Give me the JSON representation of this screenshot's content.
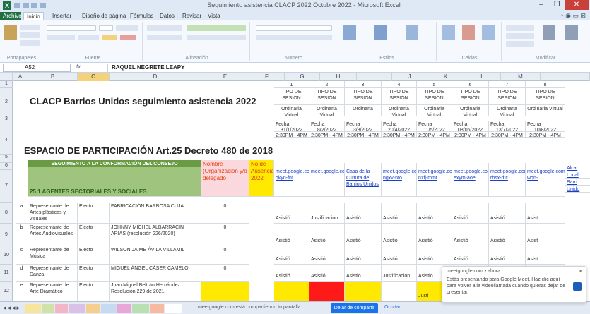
{
  "window": {
    "title": "Seguimiento asistencia CLACP 2022 Octubre 2022 - Microsoft Excel",
    "app_icon": "X",
    "minimize": "–",
    "maximize": "❐",
    "close": "✕"
  },
  "ribbon_tabs": [
    "Archivo",
    "Inicio",
    "Insertar",
    "Diseño de página",
    "Fórmulas",
    "Datos",
    "Revisar",
    "Vista"
  ],
  "ribbon_groups": [
    "Portapapeles",
    "Fuente",
    "Alineación",
    "Número",
    "Estilos",
    "Celdas",
    "Modificar"
  ],
  "formula_bar": {
    "name_box": "A52",
    "fx": "fx",
    "content": "RAQUEL NEGRETE LEAPY"
  },
  "columns": [
    {
      "label": "A",
      "selected": false
    },
    {
      "label": "B",
      "selected": false
    },
    {
      "label": "C",
      "selected": true
    },
    {
      "label": "D",
      "selected": false
    },
    {
      "label": "E",
      "selected": false
    },
    {
      "label": "F",
      "selected": false
    },
    {
      "label": "G",
      "selected": false
    },
    {
      "label": "H",
      "selected": false
    },
    {
      "label": "I",
      "selected": false
    },
    {
      "label": "J",
      "selected": false
    },
    {
      "label": "K",
      "selected": false
    },
    {
      "label": "L",
      "selected": false
    },
    {
      "label": "M",
      "selected": false
    }
  ],
  "row_numbers": [
    "1",
    "2",
    "3",
    "4",
    "5",
    "6",
    "7",
    "8",
    "9",
    "10",
    "11",
    "12"
  ],
  "sheet": {
    "title": "CLACP Barrios Unidos seguimiento asistencia 2022",
    "subtitle": "ESPACIO DE PARTICIPACIÓN Art.25 Decreto 480 de 2018",
    "section_header": "SEGUIMIENTO A LA CONFORMACIÓN DEL CONSEJO",
    "section_label": "25.1 AGENTES SECTORIALES Y SOCIALES",
    "header_nombre": "Nombre (Organización y/o delegado",
    "header_ausencias": "No de Ausencias 2022",
    "session_numbers": [
      "1",
      "2",
      "3",
      "4",
      "5",
      "6",
      "7",
      "8"
    ],
    "session_type_label": "TIPO DE SESIÓN",
    "session_modes": [
      "Ordinaria Virtual",
      "Ordinaria Virtual",
      "Ordinaria",
      "Ordinaria Virtual",
      "Ordinaria Virtual",
      "Ordinaria Virtual",
      "Ordinaria Virtual",
      "Ordinaria Virtual"
    ],
    "fecha_label": "Fecha",
    "session_dates": [
      "31/1/2022",
      "8/2/2022",
      "3/3/2022",
      "20/4/2022",
      "11/5/2022",
      "08/06/2022",
      "13/7/2022",
      "10/8/2022"
    ],
    "session_times": [
      "2:30PM - 4PM",
      "2:30PM - 4PM",
      "2:30PM - 4PM",
      "2:30PM - 4PM",
      "2:30PM - 4PM",
      "2:30PM - 4PM",
      "2:30PM - 4PM",
      "2:30PM - 4PM"
    ],
    "session_links": [
      "meet.google.com/kfe-qkyn-fnf",
      "meet.google.com/xzb-",
      "Casa de la Cultura de Barrios Unidos",
      "meet.google.com/wde-ngxv-nto",
      "meet.google.com/ebs-nzfj-mmt",
      "meet.google.com/qgeq-exym-aoe",
      "meet.google.com/mbq-rhsx-dtc",
      "meet.google.com/jpt-wqn-"
    ],
    "col_m_links": [
      "Alcal",
      "Local",
      "Barri",
      "Unido"
    ],
    "rows": [
      {
        "letter": "a",
        "sector": "Representante de Artes plásticas y visuales",
        "tipo": "Electo",
        "nombre": "FABRICACIÓN BARBOSA CUJA",
        "ausencias": "0",
        "asistencia": [
          "Asistió",
          "Justificación",
          "Asistió",
          "Asistió",
          "Asistió",
          "Asistió",
          "Asistió",
          "Asist"
        ]
      },
      {
        "letter": "b",
        "sector": "Representante de Artes Audiovisuales",
        "tipo": "Electo",
        "nombre": "JOHNNY MICHEL ALBARRACIN ARIAS (resolución 226/2020)",
        "ausencias": "0",
        "asistencia": [
          "Asistió",
          "Asistió",
          "Asistió",
          "Asistió",
          "Asistió",
          "Asistió",
          "Asistió",
          "Asist"
        ]
      },
      {
        "letter": "c",
        "sector": "Representante de Música",
        "tipo": "Electo",
        "nombre": "WILSON JAIME ÁVILA VILLAMIL",
        "ausencias": "0",
        "asistencia": [
          "Asistió",
          "Asistió",
          "Asistió",
          "Asistió",
          "Asistió",
          "Asistió",
          "Asistió",
          "Asist"
        ]
      },
      {
        "letter": "d",
        "sector": "Representante de Danza",
        "tipo": "Electo",
        "nombre": "MIGUEL ÁNGEL CÁSER CAMELO",
        "ausencias": "0",
        "asistencia": [
          "Asistió",
          "Asistió",
          "Asistió",
          "Justificación",
          "Asistió",
          "Asistió",
          "Asistió",
          "Asist"
        ]
      },
      {
        "letter": "e",
        "sector": "Representante de Arte Dramático",
        "tipo": "Electo",
        "nombre": "Juan Miguel Beltrán Hernández Resolución 229 de 2021",
        "ausencias": "",
        "asistencia": [
          "",
          "",
          "",
          "",
          "Justi",
          "",
          "",
          ""
        ]
      }
    ]
  },
  "sheet_tabs": [
    "",
    "",
    "",
    "",
    "",
    "",
    "",
    "",
    "",
    ""
  ],
  "share_bar": {
    "text": "meetgoogle.com está compartiendo tu pantalla.",
    "button": "Dejar de compartir",
    "hide": "Ocultar"
  },
  "notification": {
    "header": "meetgoogle.com • ahora",
    "text": "Estás presentando para Google Meet. Haz clic aquí para volver a la videollamada cuando quieras dejar de presentar.",
    "close": "✕"
  },
  "colors": {
    "excel_green": "#1e7145",
    "header_green": "#6a9a43",
    "yellow_cell": "#ffe900",
    "red_cell": "#ff1a1a",
    "share_blue": "#1a73e8"
  }
}
